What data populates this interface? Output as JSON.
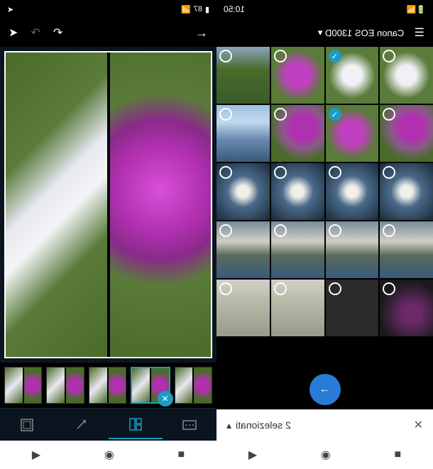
{
  "status": {
    "time": "10:50",
    "battery": "87",
    "battery_icon": "▮"
  },
  "editor": {
    "tools": [
      "frame",
      "wand",
      "layout",
      "aspect"
    ]
  },
  "gallery": {
    "title": "Canon EOS 1300D",
    "thumbs": [
      {
        "bg": "tg-green",
        "sel": false
      },
      {
        "bg": "tg-purple",
        "sel": false
      },
      {
        "bg": "tg-white",
        "sel": true
      },
      {
        "bg": "tg-white",
        "sel": false
      },
      {
        "bg": "tg-sky",
        "sel": false
      },
      {
        "bg": "tg-purple2",
        "sel": false
      },
      {
        "bg": "tg-purple",
        "sel": true
      },
      {
        "bg": "tg-purple2",
        "sel": false
      },
      {
        "bg": "tg-skydark",
        "sel": false
      },
      {
        "bg": "tg-skydark",
        "sel": false
      },
      {
        "bg": "tg-skydark",
        "sel": false
      },
      {
        "bg": "tg-skydark",
        "sel": false
      },
      {
        "bg": "tg-clouds",
        "sel": false
      },
      {
        "bg": "tg-clouds",
        "sel": false
      },
      {
        "bg": "tg-clouds",
        "sel": false
      },
      {
        "bg": "tg-clouds",
        "sel": false
      },
      {
        "bg": "tg-road",
        "sel": false
      },
      {
        "bg": "tg-road",
        "sel": false
      },
      {
        "bg": "tg-dark",
        "sel": false
      },
      {
        "bg": "tg-purpledark",
        "sel": false
      }
    ]
  },
  "selection": {
    "count_text": "2 selezionati",
    "close": "✕"
  },
  "icons": {
    "share": "➤",
    "undo": "↶",
    "redo": "↷",
    "next": "→",
    "dropdown": "▾",
    "menu": "☰",
    "back_arrow": "←",
    "check": "✓",
    "expand": "▴",
    "play": "▶",
    "circle": "◉",
    "square": "■",
    "swap": "✕"
  }
}
